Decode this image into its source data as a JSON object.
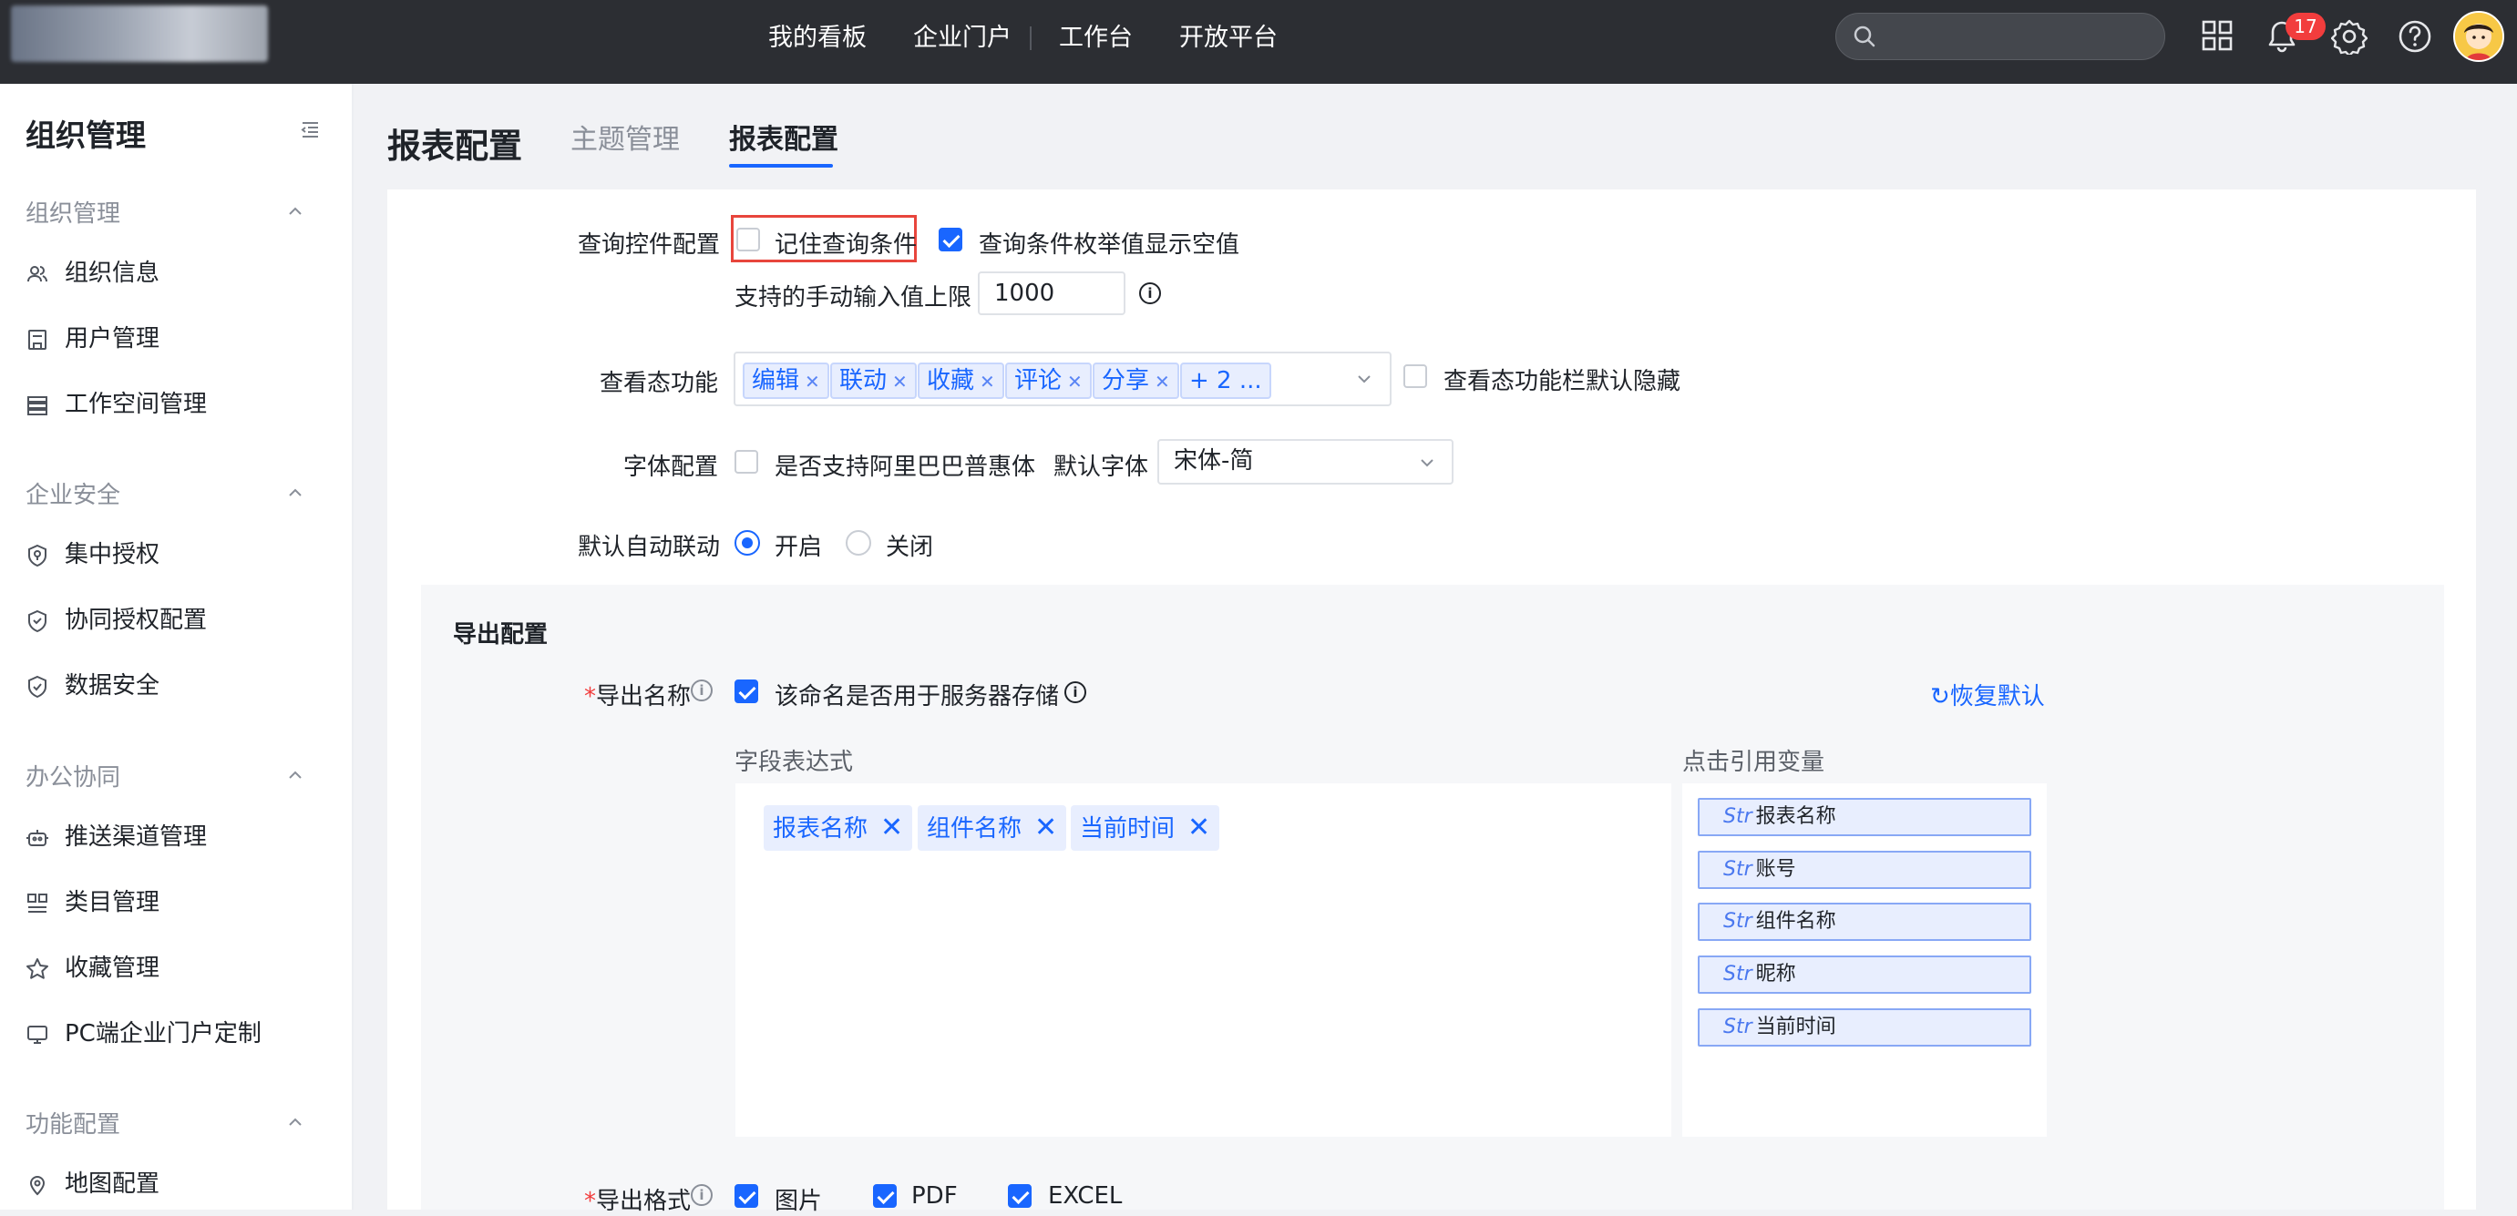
{
  "topbar": {
    "nav": [
      "我的看板",
      "企业门户",
      "工作台",
      "开放平台"
    ],
    "search_placeholder": "",
    "notification_count": "17"
  },
  "sidebar": {
    "title": "组织管理",
    "groups": [
      {
        "label": "组织管理",
        "items": [
          "组织信息",
          "用户管理",
          "工作空间管理"
        ]
      },
      {
        "label": "企业安全",
        "items": [
          "集中授权",
          "协同授权配置",
          "数据安全"
        ]
      },
      {
        "label": "办公协同",
        "items": [
          "推送渠道管理",
          "类目管理",
          "收藏管理",
          "PC端企业门户定制"
        ]
      },
      {
        "label": "功能配置",
        "items": [
          "地图配置"
        ]
      }
    ]
  },
  "main": {
    "page_title": "报表配置",
    "tabs": [
      {
        "label": "主题管理",
        "active": false
      },
      {
        "label": "报表配置",
        "active": true
      }
    ]
  },
  "query_control": {
    "label": "查询控件配置",
    "remember_conditions": {
      "label": "记住查询条件",
      "checked": false
    },
    "show_empty_enum": {
      "label": "查询条件枚举值显示空值",
      "checked": true
    },
    "manual_limit_label": "支持的手动输入值上限",
    "manual_limit_value": "1000"
  },
  "view_features": {
    "label": "查看态功能",
    "tags": [
      "编辑",
      "联动",
      "收藏",
      "评论",
      "分享"
    ],
    "more": "+ 2 ...",
    "hide_default": {
      "label": "查看态功能栏默认隐藏",
      "checked": false
    }
  },
  "font_config": {
    "label": "字体配置",
    "alibaba_font": {
      "label": "是否支持阿里巴巴普惠体",
      "checked": false
    },
    "default_font_label": "默认字体",
    "default_font_value": "宋体-简"
  },
  "auto_link": {
    "label": "默认自动联动",
    "options": [
      {
        "label": "开启",
        "selected": true
      },
      {
        "label": "关闭",
        "selected": false
      }
    ]
  },
  "export": {
    "section_title": "导出配置",
    "name_label": "导出名称",
    "server_storage": {
      "label": "该命名是否用于服务器存储",
      "checked": true
    },
    "restore_default": "恢复默认",
    "expr_label": "字段表达式",
    "expr_tags": [
      "报表名称",
      "组件名称",
      "当前时间"
    ],
    "vars_label": "点击引用变量",
    "vars": [
      "报表名称",
      "账号",
      "组件名称",
      "昵称",
      "当前时间"
    ],
    "var_prefix": "Str",
    "format_label": "导出格式",
    "formats": [
      {
        "label": "图片",
        "checked": true
      },
      {
        "label": "PDF",
        "checked": true
      },
      {
        "label": "EXCEL",
        "checked": true
      }
    ]
  },
  "colors": {
    "accent": "#1966ff",
    "topbar": "#2c2e33",
    "badge": "#f23d3d",
    "highlight": "#e8453c"
  }
}
